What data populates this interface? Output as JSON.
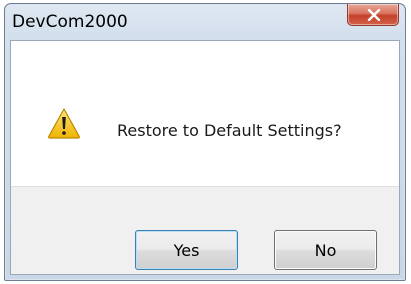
{
  "window": {
    "title": "DevCom2000"
  },
  "dialog": {
    "message": "Restore to Default Settings?",
    "icon": "warning-icon"
  },
  "buttons": {
    "yes_label": "Yes",
    "no_label": "No"
  },
  "colors": {
    "close_button": "#c4412a",
    "warning_fill": "#f5c518",
    "frame": "#d2dfec"
  }
}
